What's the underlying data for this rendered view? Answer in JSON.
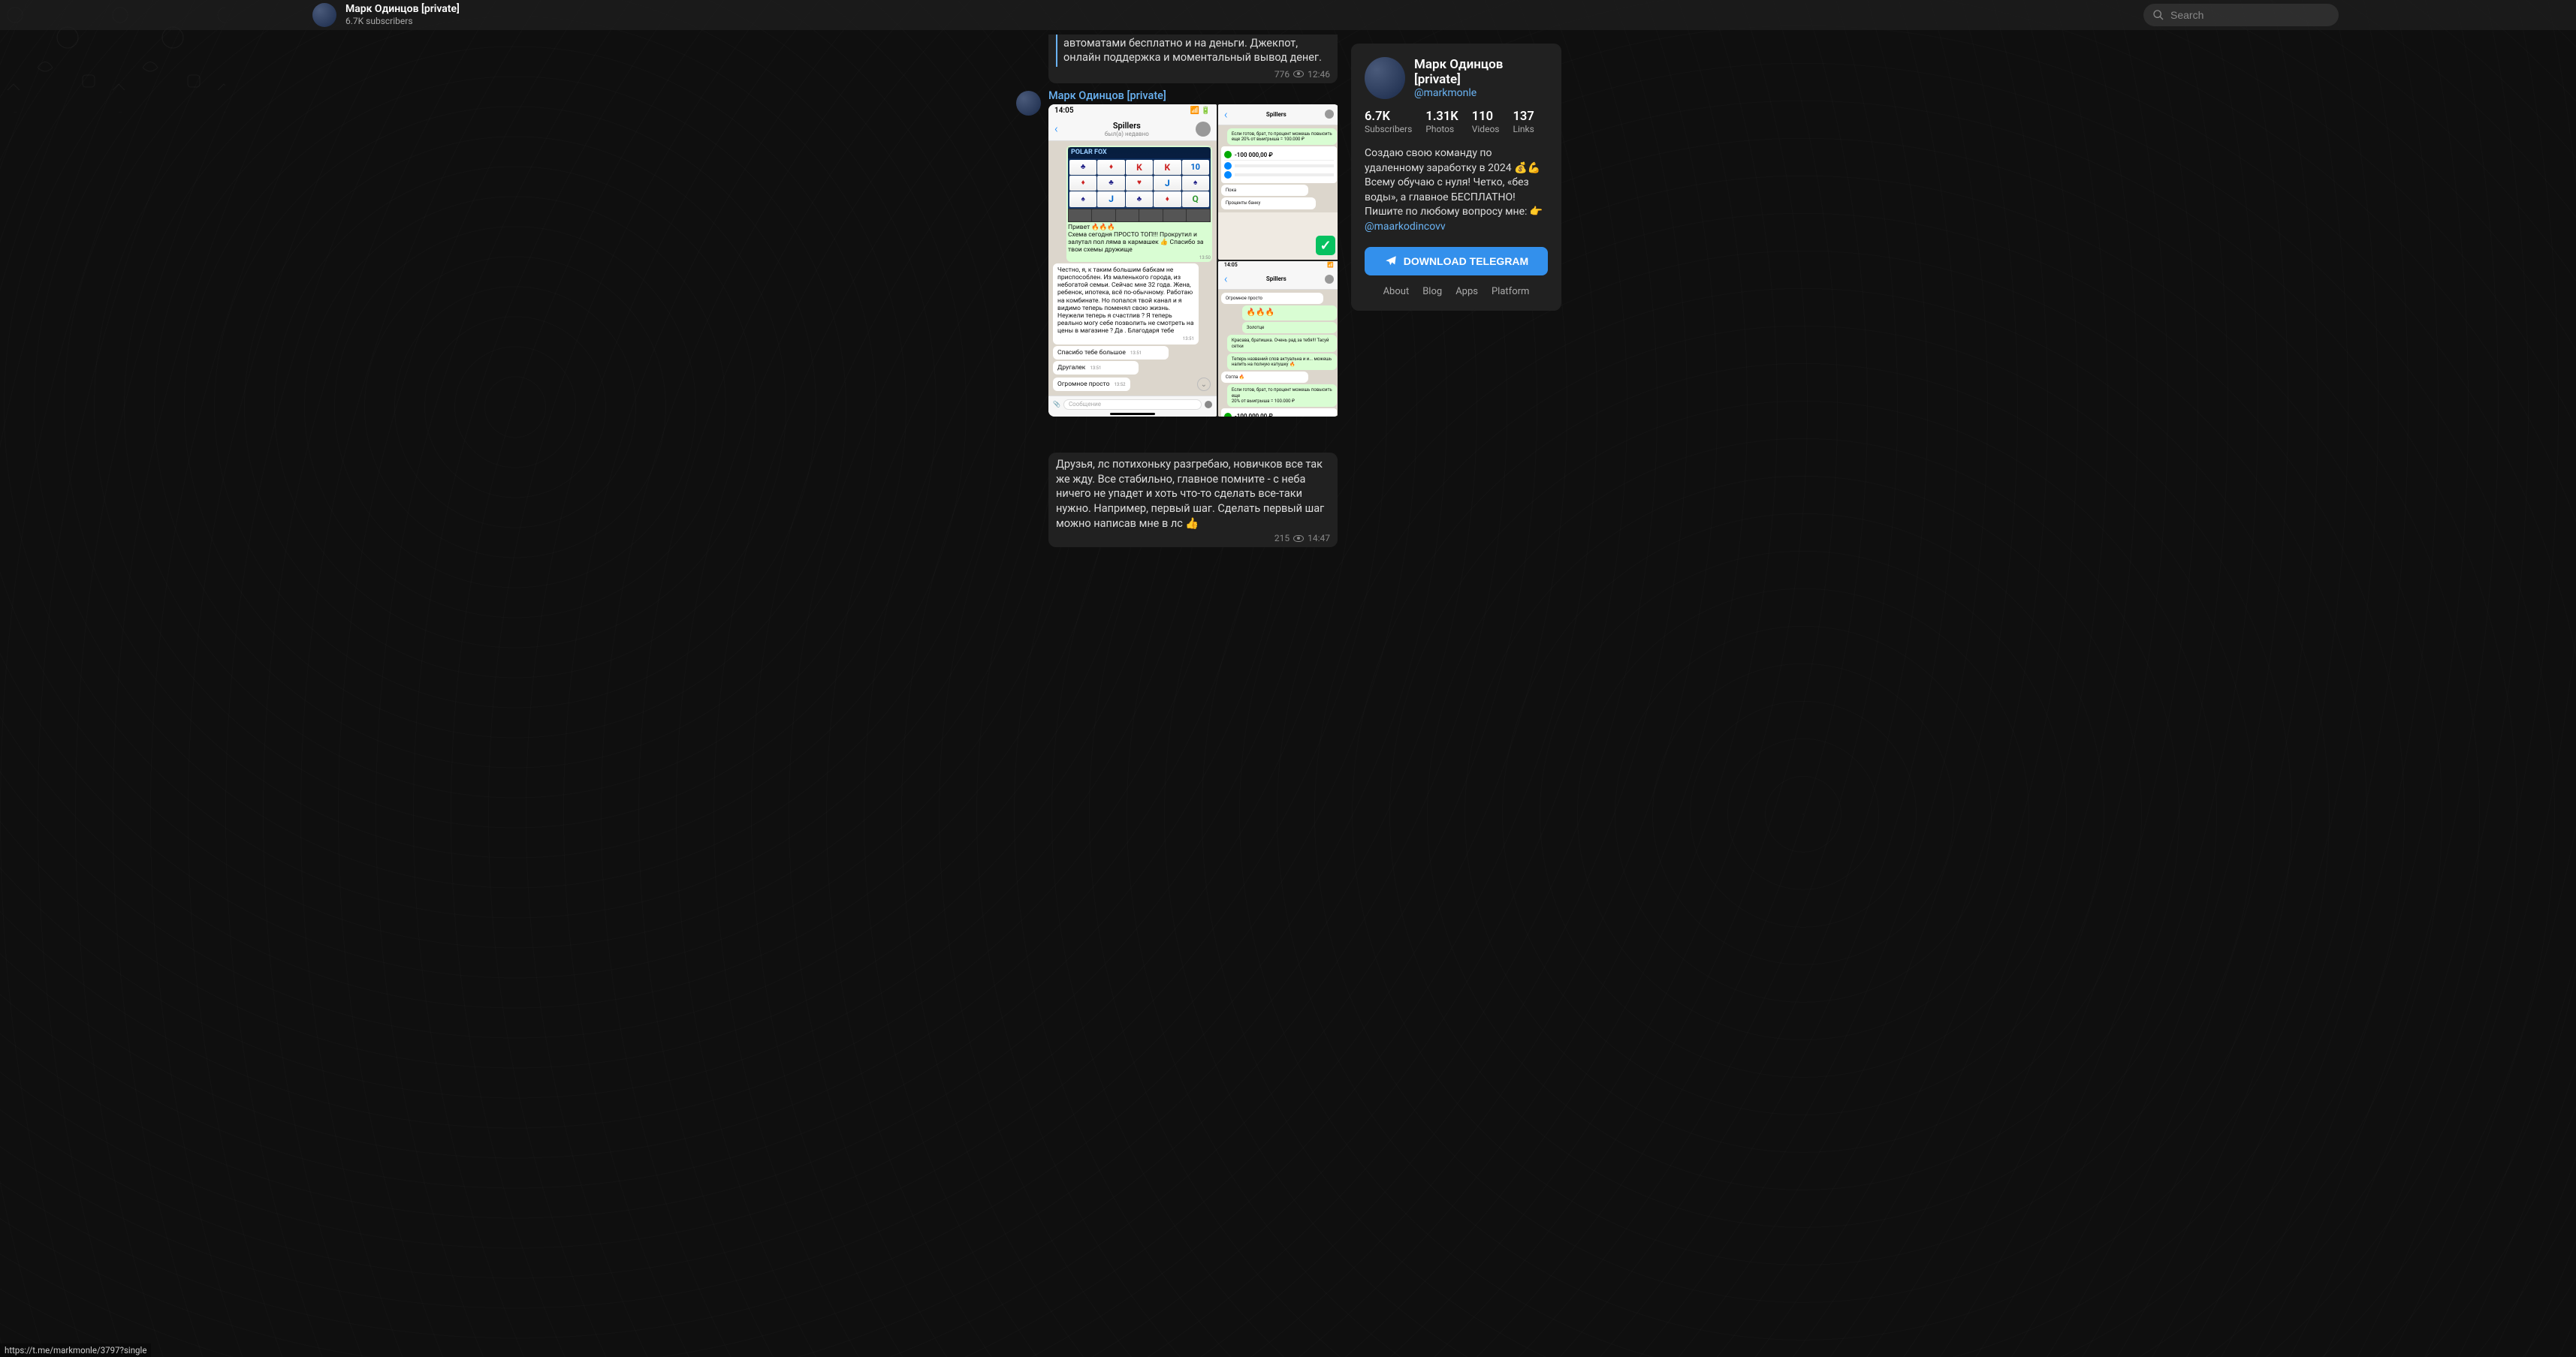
{
  "header": {
    "channel_title": "Марк Одинцов [private]",
    "subscribers": "6.7K subscribers"
  },
  "search": {
    "placeholder": "Search"
  },
  "messages": {
    "m0": {
      "text": "Официальное онлайн казино вулкан с игровыми автоматами бесплатно и на деньги. Джекпот, онлайн поддержка и моментальный вывод денег.",
      "views": "776",
      "time": "12:46"
    },
    "m1": {
      "sender": "Марк Одинцов [private]",
      "views": "215",
      "time": "14:47",
      "caption": "Друзья, лс потихоньку разгребаю, новичков все так же жду. Все стабильно, главное помните - с неба ничего не упадет и хоть что-то сделать все-таки нужно. Например, первый шаг. Сделать первый шаг можно написав мне в лс 👍"
    }
  },
  "phone_mock": {
    "time": "14:05",
    "chat_name": "Spillers",
    "chat_status": "был(а) недавно",
    "slot_title": "POLAR FOX",
    "reel_symbols": [
      "♣",
      "♦",
      "K",
      "K",
      "10",
      "♦",
      "♣",
      "♥",
      "J",
      "♠",
      "♠",
      "J",
      "♣",
      "♦",
      "Q"
    ],
    "msg_out_1": "Привет 🔥🔥🔥\nСхема сегодня ПРОСТО ТОП!!! Прокрутил и залутал пол ляма в кармашек 👍 Спасибо за твои схемы дружище",
    "msg_out_1_time": "13:50",
    "msg_in_1": "Честно, я, к таким большим бабкам не приспособлен. Из маленького города, из небогатой семьи. Сейчас мне 32 года. Жена, ребенок, ипотека, всё по-обычному. Работаю на комбинате. Но попался твой канал и я видимо теперь поменял свою жизнь. Неужели теперь я счастлив ? Я теперь реально могу себе позволить не смотреть на цены в магазине ? Да . Благодаря тебе",
    "msg_in_1_time": "13:51",
    "msg_in_2": "Спасибо тебе большое",
    "msg_in_2_time": "13:51",
    "msg_in_3": "Другалек",
    "msg_in_3_time": "13:51",
    "msg_in_4": "Огромное просто",
    "msg_in_4_time": "13:52",
    "input_placeholder": "Сообщение",
    "r_top_1": "Если готов, брат, то процент можешь повысить еще\n20% от выигрыша = 100.000 ₽",
    "r_top_label": "Пока",
    "r_top_label2": "Проценты банку",
    "r_amount": "-100 000,00 ₽",
    "r_mid_1": "Огромное просто",
    "r_mid_fire": "🔥🔥🔥",
    "r_mid_2": "Золотце",
    "r_mid_3": "Красава, братишка. Очень рад за тебя!!! Тасуй сетки",
    "r_mid_4": "Теперь названий слов актуальна и и... можешь налить на полную катушку 🔥",
    "r_mid_5": "Согла 🔥",
    "r_mid_6": "Если готов, брат, то процент можешь повысить еще\n20% от выигрыша = 100.000 ₽"
  },
  "sidebar": {
    "title": "Марк Одинцов [private]",
    "username": "@markmonle",
    "stats": {
      "subs_num": "6.7K",
      "subs_label": "Subscribers",
      "photos_num": "1.31K",
      "photos_label": "Photos",
      "videos_num": "110",
      "videos_label": "Videos",
      "links_num": "137",
      "links_label": "Links"
    },
    "desc_line1": "Создаю свою команду по удаленному заработку в 2024 💰💪",
    "desc_line2": "Всему обучаю с нуля! Четко, «без воды», а главное БЕСПЛАТНО!",
    "desc_line3": "Пишите по любому вопросу мне: 👉",
    "desc_mention": "@maarkodincovv",
    "download_btn": "DOWNLOAD TELEGRAM",
    "footer": {
      "about": "About",
      "blog": "Blog",
      "apps": "Apps",
      "platform": "Platform"
    }
  },
  "status_url": "https://t.me/markmonle/3797?single"
}
